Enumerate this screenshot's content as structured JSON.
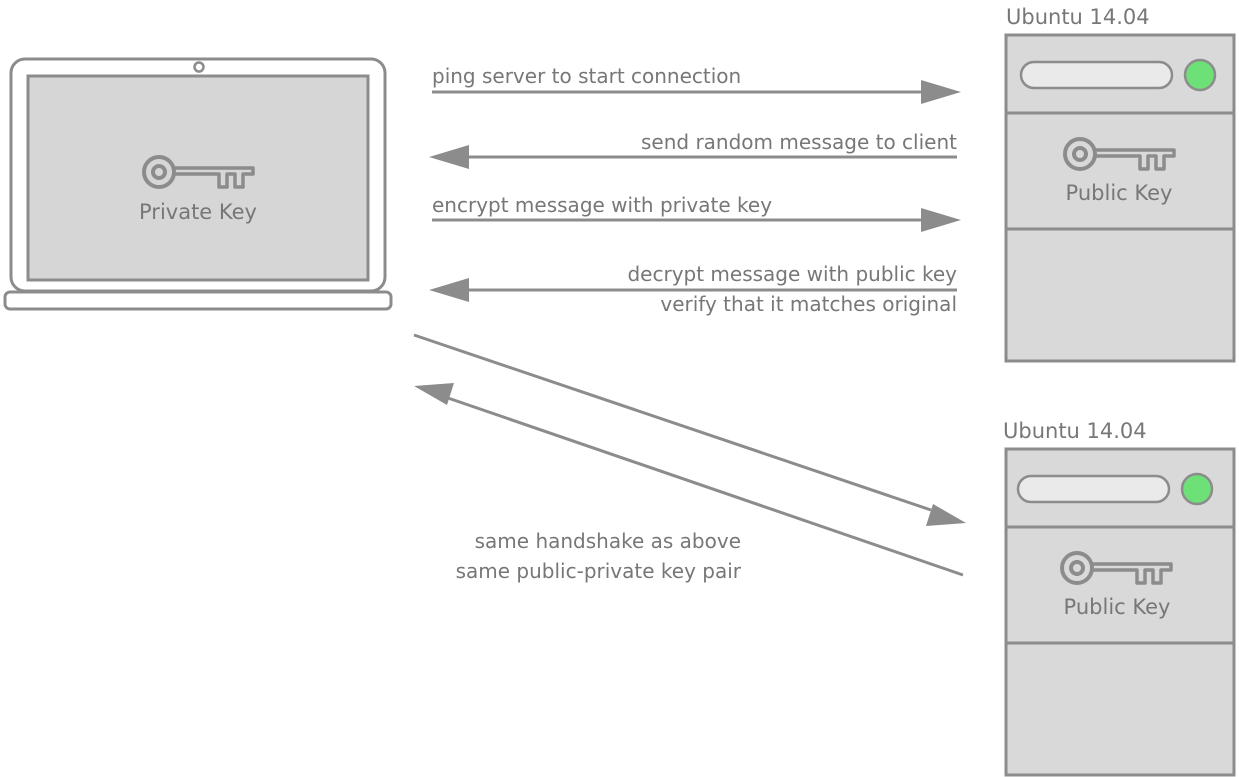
{
  "laptop": {
    "key_label": "Private Key"
  },
  "servers": [
    {
      "os_label": "Ubuntu 14.04",
      "key_label": "Public Key"
    },
    {
      "os_label": "Ubuntu 14.04",
      "key_label": "Public Key"
    }
  ],
  "handshake": {
    "steps": [
      {
        "label": "ping server to start connection",
        "direction": "to-server"
      },
      {
        "label": "send random message to client",
        "direction": "to-client"
      },
      {
        "label": "encrypt message with private key",
        "direction": "to-server"
      },
      {
        "label": "decrypt message with public key",
        "label_2": "verify that it matches original",
        "direction": "to-client"
      }
    ]
  },
  "second_connection": {
    "line_1": "same handshake as above",
    "line_2": "same public-private key pair"
  },
  "colors": {
    "stroke": "#8c8c8c",
    "panel_fill": "#d9d9d9",
    "screen_fill": "#d6d6d6",
    "status_light": "#6ee078",
    "text": "#777777"
  },
  "icons": {
    "laptop": "laptop-icon",
    "key": "key-icon",
    "server": "server-icon",
    "status": "status-light-icon"
  }
}
